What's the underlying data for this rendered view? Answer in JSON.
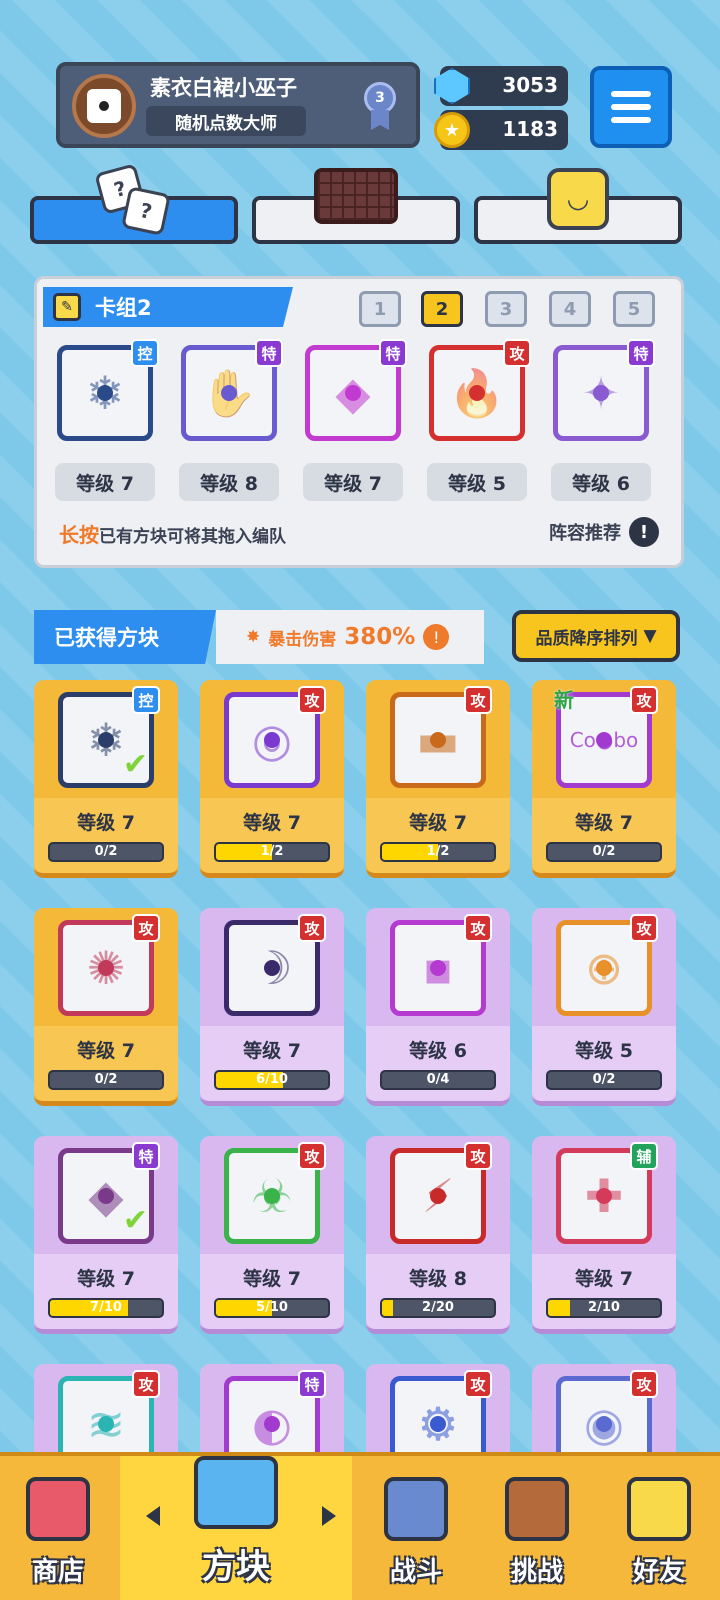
{
  "profile": {
    "name": "素衣白裙小巫子",
    "title": "随机点数大师",
    "rank": "3"
  },
  "currency": {
    "gems": "3053",
    "coins": "1183"
  },
  "top_tabs": [
    {
      "name": "dice",
      "active": true
    },
    {
      "name": "board",
      "active": false
    },
    {
      "name": "emote",
      "active": false
    }
  ],
  "deck": {
    "title": "卡组2",
    "slots": [
      "1",
      "2",
      "3",
      "4",
      "5"
    ],
    "active_slot": "2",
    "cards": [
      {
        "tag": "控",
        "tag_type": "ctrl",
        "level": "等级 7",
        "color": "#2b4a8a",
        "glyph": "❄"
      },
      {
        "tag": "特",
        "tag_type": "spec",
        "level": "等级 8",
        "color": "#6a5ad0",
        "glyph": "✋"
      },
      {
        "tag": "特",
        "tag_type": "spec",
        "level": "等级 7",
        "color": "#c23ad0",
        "glyph": "◆"
      },
      {
        "tag": "攻",
        "tag_type": "atk",
        "level": "等级 5",
        "color": "#d43030",
        "glyph": "🔥"
      },
      {
        "tag": "特",
        "tag_type": "spec",
        "level": "等级 6",
        "color": "#8a5ad0",
        "glyph": "✦"
      }
    ],
    "hint_strong": "长按",
    "hint_rest": "已有方块可将其拖入编队",
    "recommend": "阵容推荐",
    "recommend_icon": "!"
  },
  "obtained": {
    "title": "已获得方块",
    "crit_label": "暴击伤害",
    "crit_value": "380%",
    "crit_icon": "!",
    "sort_label": "品质降序排列",
    "sort_arrow": "▼"
  },
  "cubes": [
    {
      "tag": "控",
      "tag_type": "ctrl",
      "level": "等级 7",
      "progress": "0/2",
      "fraction": 0,
      "rarity": "gold",
      "color": "#2b3e6a",
      "glyph": "❄",
      "check": "✔",
      "new": ""
    },
    {
      "tag": "攻",
      "tag_type": "atk",
      "level": "等级 7",
      "progress": "1/2",
      "fraction": 0.5,
      "rarity": "gold",
      "color": "#7a3ad0",
      "glyph": "◎",
      "check": "",
      "new": ""
    },
    {
      "tag": "攻",
      "tag_type": "atk",
      "level": "等级 7",
      "progress": "1/2",
      "fraction": 0.5,
      "rarity": "gold",
      "color": "#c86a1a",
      "glyph": "▬",
      "check": "",
      "new": ""
    },
    {
      "tag": "攻",
      "tag_type": "atk",
      "level": "等级 7",
      "progress": "0/2",
      "fraction": 0,
      "rarity": "gold",
      "color": "#a33ad0",
      "glyph": "Co●bo",
      "check": "",
      "new": "新"
    },
    {
      "tag": "攻",
      "tag_type": "atk",
      "level": "等级 7",
      "progress": "0/2",
      "fraction": 0,
      "rarity": "gold",
      "color": "#c23a5a",
      "glyph": "✺",
      "check": "",
      "new": ""
    },
    {
      "tag": "攻",
      "tag_type": "atk",
      "level": "等级 7",
      "progress": "6/10",
      "fraction": 0.6,
      "rarity": "purple",
      "color": "#3a2a6a",
      "glyph": "☽",
      "check": "",
      "new": ""
    },
    {
      "tag": "攻",
      "tag_type": "atk",
      "level": "等级 6",
      "progress": "0/4",
      "fraction": 0,
      "rarity": "purple",
      "color": "#b43ad0",
      "glyph": "▪",
      "check": "",
      "new": ""
    },
    {
      "tag": "攻",
      "tag_type": "atk",
      "level": "等级 5",
      "progress": "0/2",
      "fraction": 0,
      "rarity": "purple",
      "color": "#e8902a",
      "glyph": "⊕",
      "check": "",
      "new": ""
    },
    {
      "tag": "特",
      "tag_type": "spec",
      "level": "等级 7",
      "progress": "7/10",
      "fraction": 0.7,
      "rarity": "purple",
      "color": "#7a3a8a",
      "glyph": "◆",
      "check": "✔",
      "new": ""
    },
    {
      "tag": "攻",
      "tag_type": "atk",
      "level": "等级 7",
      "progress": "5/10",
      "fraction": 0.5,
      "rarity": "purple",
      "color": "#3ab44a",
      "glyph": "☣",
      "check": "",
      "new": ""
    },
    {
      "tag": "攻",
      "tag_type": "atk",
      "level": "等级 8",
      "progress": "2/20",
      "fraction": 0.1,
      "rarity": "purple",
      "color": "#c82a2a",
      "glyph": "⚡",
      "check": "",
      "new": ""
    },
    {
      "tag": "辅",
      "tag_type": "sup",
      "level": "等级 7",
      "progress": "2/10",
      "fraction": 0.2,
      "rarity": "purple",
      "color": "#d43a5a",
      "glyph": "✚",
      "check": "",
      "new": ""
    },
    {
      "tag": "攻",
      "tag_type": "atk",
      "level": "",
      "progress": "",
      "fraction": 0,
      "rarity": "purple",
      "color": "#2ab4b4",
      "glyph": "≋",
      "check": "",
      "new": ""
    },
    {
      "tag": "特",
      "tag_type": "spec",
      "level": "",
      "progress": "",
      "fraction": 0,
      "rarity": "purple",
      "color": "#a33ad0",
      "glyph": "◐",
      "check": "",
      "new": ""
    },
    {
      "tag": "攻",
      "tag_type": "atk",
      "level": "",
      "progress": "",
      "fraction": 0,
      "rarity": "purple",
      "color": "#3a5ad0",
      "glyph": "⚙",
      "check": "",
      "new": ""
    },
    {
      "tag": "攻",
      "tag_type": "atk",
      "level": "",
      "progress": "",
      "fraction": 0,
      "rarity": "purple",
      "color": "#5a6ad0",
      "glyph": "◉",
      "check": "",
      "new": ""
    }
  ],
  "nav": [
    {
      "label": "商店",
      "icon": "shop-icon",
      "active": false,
      "color": "#e85a6a"
    },
    {
      "label": "方块",
      "icon": "cube-icon",
      "active": true,
      "color": "#5ab4f0"
    },
    {
      "label": "战斗",
      "icon": "battle-icon",
      "active": false,
      "color": "#6a8ad0"
    },
    {
      "label": "挑战",
      "icon": "challenge-icon",
      "active": false,
      "color": "#b46a3a"
    },
    {
      "label": "好友",
      "icon": "friends-icon",
      "active": false,
      "color": "#f7d94a"
    }
  ]
}
